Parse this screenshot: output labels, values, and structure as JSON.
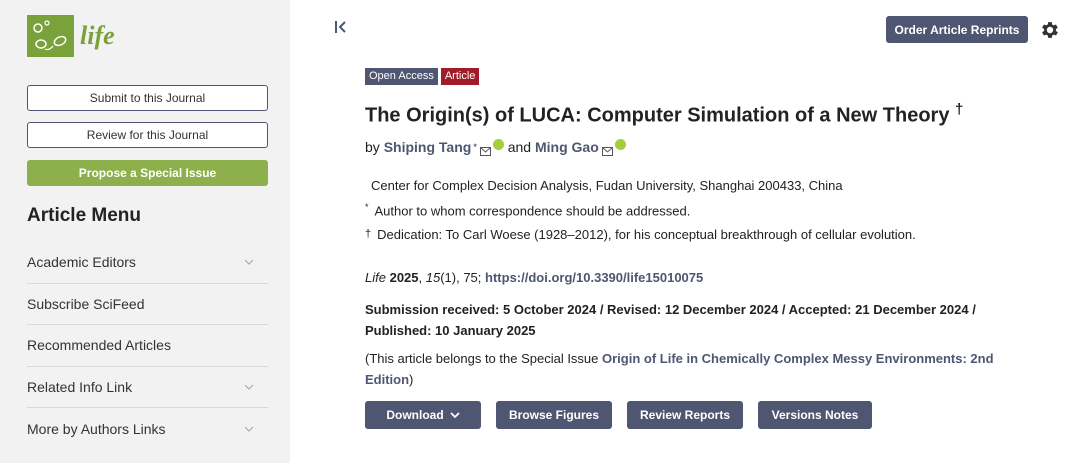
{
  "sidebar": {
    "journal_name": "life",
    "brand_color": "#7aa23a",
    "buttons": {
      "submit": "Submit to this Journal",
      "review": "Review for this Journal",
      "propose": "Propose a Special Issue"
    },
    "menu_title": "Article Menu",
    "menu_items": [
      {
        "label": "Academic Editors",
        "expandable": true
      },
      {
        "label": "Subscribe SciFeed",
        "expandable": false
      },
      {
        "label": "Recommended Articles",
        "expandable": false
      },
      {
        "label": "Related Info Link",
        "expandable": true
      },
      {
        "label": "More by Authors Links",
        "expandable": true
      }
    ]
  },
  "header": {
    "collapse_icon": "collapse-left-icon",
    "order_reprints": "Order Article Reprints",
    "settings_icon": "gear-icon"
  },
  "article": {
    "badges": {
      "open_access": "Open Access",
      "type": "Article"
    },
    "title": "The Origin(s) of LUCA: Computer Simulation of a New Theory",
    "title_mark": "†",
    "by": "by",
    "author1": "Shiping Tang",
    "author1_mark": "*",
    "and": "and",
    "author2": "Ming Gao",
    "affiliation": "Center for Complex Decision Analysis, Fudan University, Shanghai 200433, China",
    "correspondence_mark": "*",
    "correspondence": "Author to whom correspondence should be addressed.",
    "dedication_mark": "†",
    "dedication": "Dedication: To Carl Woese (1928–2012), for his conceptual breakthrough of cellular evolution.",
    "citation": {
      "journal": "Life",
      "year": "2025",
      "volume": "15",
      "issue_pages": "(1), 75;",
      "doi": "https://doi.org/10.3390/life15010075"
    },
    "dates": "Submission received: 5 October 2024 / Revised: 12 December 2024 / Accepted: 21 December 2024 / Published: 10 January 2025",
    "special_prefix": "(This article belongs to the Special Issue ",
    "special_link": "Origin of Life in Chemically Complex Messy Environments: 2nd Edition",
    "special_suffix": ")"
  },
  "actions": {
    "download": "Download",
    "browse_figures": "Browse Figures",
    "review_reports": "Review Reports",
    "versions_notes": "Versions Notes"
  },
  "colors": {
    "primary": "#4f5671",
    "article_badge": "#a01c2a",
    "green": "#8db04d",
    "orcid": "#a6ce39"
  }
}
